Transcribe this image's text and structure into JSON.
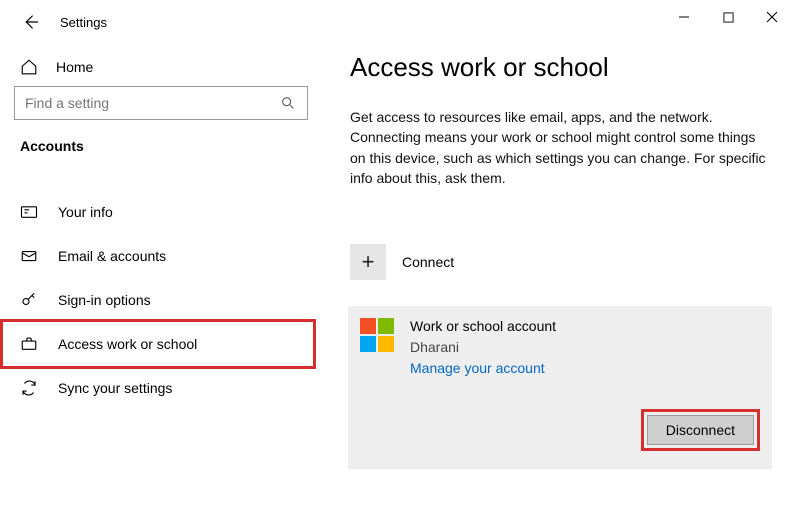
{
  "window": {
    "title": "Settings",
    "home_label": "Home",
    "search_placeholder": "Find a setting",
    "section_label": "Accounts"
  },
  "nav": {
    "items": [
      {
        "label": "Your info"
      },
      {
        "label": "Email & accounts"
      },
      {
        "label": "Sign-in options"
      },
      {
        "label": "Access work or school"
      },
      {
        "label": "Sync your settings"
      }
    ]
  },
  "page": {
    "heading": "Access work or school",
    "description": "Get access to resources like email, apps, and the network. Connecting means your work or school might control some things on this device, such as which settings you can change. For specific info about this, ask them.",
    "connect_label": "Connect"
  },
  "account": {
    "title": "Work or school account",
    "name": "Dharani",
    "manage_label": "Manage your account",
    "disconnect_label": "Disconnect",
    "logo_colors": {
      "tl": "#f25022",
      "tr": "#7fba00",
      "bl": "#00a4ef",
      "br": "#ffb900"
    }
  }
}
